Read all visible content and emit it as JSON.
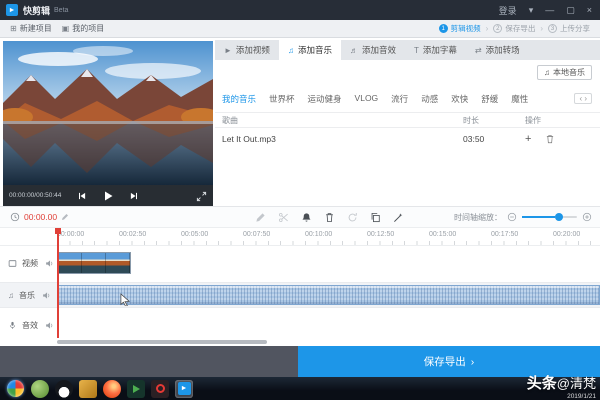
{
  "titlebar": {
    "app_name": "快剪辑",
    "badge": "Beta",
    "login_label": "登录"
  },
  "projectbar": {
    "new_project_label": "新建项目",
    "my_projects_label": "我的项目",
    "steps": [
      {
        "num": "1",
        "label": "剪辑视频"
      },
      {
        "num": "2",
        "label": "保存导出"
      },
      {
        "num": "3",
        "label": "上传分享"
      }
    ]
  },
  "preview": {
    "time_display": "00:00:00/00:50:44"
  },
  "music_panel": {
    "tabs": [
      {
        "label": "添加视频"
      },
      {
        "label": "添加音乐"
      },
      {
        "label": "添加音效"
      },
      {
        "label": "添加字幕"
      },
      {
        "label": "添加转场"
      }
    ],
    "active_tab": "添加音乐",
    "local_music_label": "本地音乐",
    "categories": [
      "我的音乐",
      "世界杯",
      "运动健身",
      "VLOG",
      "流行",
      "动感",
      "欢快",
      "舒缓",
      "魔性"
    ],
    "active_category": "我的音乐",
    "table_headers": {
      "song": "歌曲",
      "duration": "时长",
      "actions": "操作"
    },
    "songs": [
      {
        "name": "Let It Out.mp3",
        "duration": "03:50"
      }
    ]
  },
  "timeline": {
    "current_time": "00:00.00",
    "zoom_control_label": "时间轴缩放：",
    "ruler_labels": [
      "00:00:00",
      "00:02:50",
      "00:05:00",
      "00:07:50",
      "00:10:00",
      "00:12:50",
      "00:15:00",
      "00:17:50",
      "00:20:00"
    ],
    "tracks": [
      {
        "label": "视频"
      },
      {
        "label": "音乐"
      },
      {
        "label": "音效"
      }
    ]
  },
  "export": {
    "button_label": "保存导出",
    "chevron": "›"
  },
  "watermark": {
    "brand": "头条",
    "handle": "@清梵",
    "date": "2019/1/21"
  },
  "icons": {
    "logo_glyph": "►",
    "dropdown_glyph": "▾",
    "minimize_glyph": "—",
    "maximize_glyph": "▢",
    "close_glyph": "×",
    "new_project_glyph": "⊞",
    "my_projects_glyph": "▣",
    "video_tab_glyph": "►",
    "music_note_glyph": "♫",
    "sound_tab_glyph": "♬",
    "subtitle_glyph": "T",
    "transition_glyph": "⇄",
    "pager_glyph": "‹ ›",
    "plus_glyph": "+"
  },
  "colors": {
    "accent_blue": "#1d96e8",
    "playhead_red": "#e04038",
    "music_clip_blue": "#aac6e4",
    "titlebar_dark": "#272d37"
  }
}
